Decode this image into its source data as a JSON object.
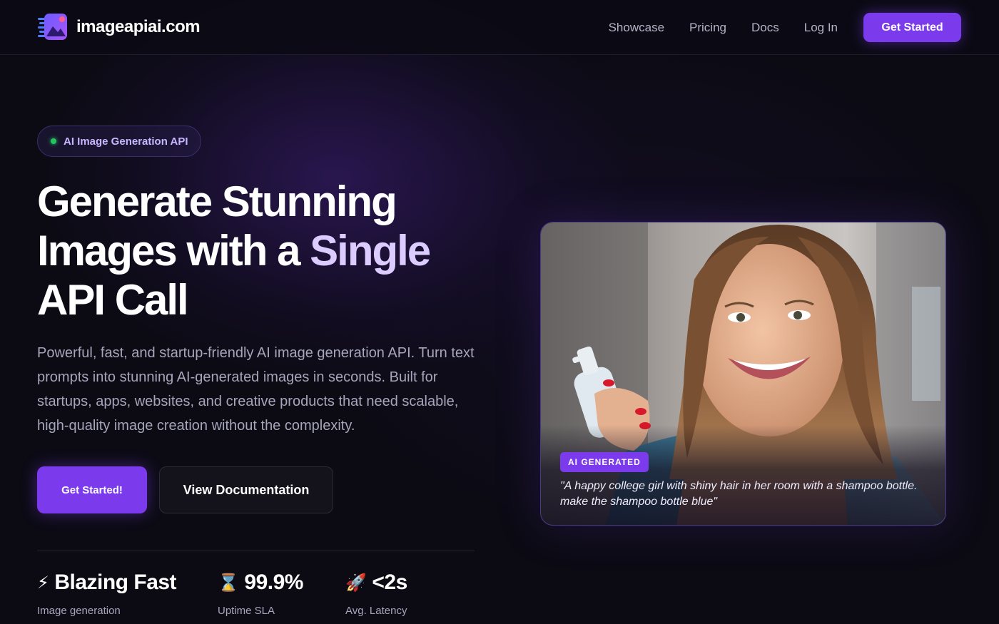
{
  "nav": {
    "logo_text": "imageapiai.com",
    "links": [
      "Showcase",
      "Pricing",
      "Docs",
      "Log In"
    ],
    "cta_label": "Get Started"
  },
  "hero": {
    "badge": "AI Image Generation API",
    "headline_line1": "Generate Stunning",
    "headline_line2_a": "Images with a ",
    "headline_line2_b": "Single",
    "headline_line3": "API Call",
    "description": "Powerful, fast, and startup-friendly AI image generation API. Turn text prompts into stunning AI-generated images in seconds. Built for startups, apps, websites, and creative products that need scalable, high-quality image creation without the complexity.",
    "primary_button": "Get Started!",
    "secondary_button": "View Documentation"
  },
  "stats": [
    {
      "icon": "⚡",
      "value": "Blazing Fast",
      "label": "Image generation"
    },
    {
      "icon": "⌛",
      "value": "99.9%",
      "label": "Uptime SLA"
    },
    {
      "icon": "🚀",
      "value": "<2s",
      "label": "Avg. Latency"
    }
  ],
  "showcase_card": {
    "tag": "AI GENERATED",
    "caption": "\"A happy college girl with shiny hair in her room with a shampoo bottle. make the shampoo bottle blue\""
  },
  "colors": {
    "accent": "#7c3aed",
    "accent_light": "#dccbff",
    "background": "#0c0b14",
    "muted_text": "#a7a5bb",
    "status_dot": "#22c55e"
  },
  "icons": [
    "logo-image-icon",
    "status-dot-icon",
    "lightning-icon",
    "hourglass-icon",
    "rocket-icon"
  ]
}
